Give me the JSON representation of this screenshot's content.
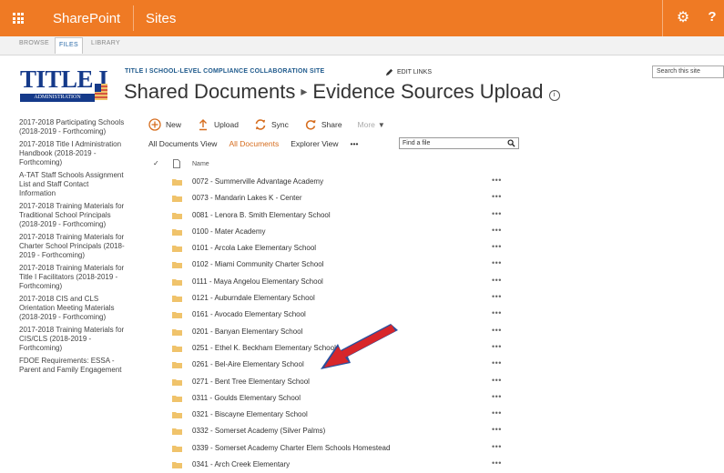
{
  "suite_bar": {
    "brand": "SharePoint",
    "sites": "Sites",
    "help": "?"
  },
  "ribbon": {
    "tabs": [
      "BROWSE",
      "FILES",
      "LIBRARY"
    ]
  },
  "logo": {
    "word": "TITLE I",
    "sub": "ADMINISTRATION"
  },
  "site": {
    "name": "TITLE I SCHOOL-LEVEL COMPLIANCE COLLABORATION SITE",
    "edit_links": "EDIT LINKS",
    "title_part1": "Shared Documents",
    "title_sep": "▸",
    "title_part2": "Evidence Sources Upload",
    "search_placeholder": "Search this site"
  },
  "nav": [
    "2017-2018 Participating Schools (2018-2019 - Forthcoming)",
    "2017-2018 Title I Administration Handbook (2018-2019 - Forthcoming)",
    "A-TAT Staff Schools Assignment List and Staff Contact Information",
    "2017-2018 Training Materials for Traditional School Principals (2018-2019 - Forthcoming)",
    "2017-2018 Training Materials for Charter School Principals (2018-2019 - Forthcoming)",
    "2017-2018 Training Materials for Title I Facilitators (2018-2019 - Forthcoming)",
    "2017-2018 CIS and CLS Orientation Meeting Materials (2018-2019 - Forthcoming)",
    "2017-2018 Training Materials for CIS/CLS (2018-2019 - Forthcoming)",
    "FDOE Requirements: ESSA - Parent and Family Engagement"
  ],
  "commands": {
    "new": "New",
    "upload": "Upload",
    "sync": "Sync",
    "share": "Share",
    "more": "More"
  },
  "views": {
    "all_view": "All Documents View",
    "all_docs": "All Documents",
    "explorer": "Explorer View",
    "ellipsis": "•••",
    "find_placeholder": "Find a file"
  },
  "list": {
    "header_name": "Name",
    "row_menu": "•••",
    "rows": [
      "0072 - Summerville Advantage Academy",
      "0073 - Mandarin Lakes K - Center",
      "0081 - Lenora B. Smith Elementary School",
      "0100 - Mater Academy",
      "0101 - Arcola Lake Elementary School",
      "0102 - Miami Community Charter School",
      "0111 - Maya Angelou Elementary School",
      "0121 - Auburndale Elementary School",
      "0161 - Avocado Elementary School",
      "0201 - Banyan Elementary School",
      "0251 - Ethel K. Beckham Elementary School",
      "0261 - Bel-Aire Elementary School",
      "0271 - Bent Tree Elementary School",
      "0311 - Goulds Elementary School",
      "0321 - Biscayne Elementary School",
      "0332 - Somerset Academy (Silver Palms)",
      "0339 - Somerset Academy Charter Elem Schools Homestead",
      "0341 - Arch Creek Elementary"
    ]
  },
  "colors": {
    "suite_bar": "#ef7a24",
    "active_view": "#d66d1e",
    "link_blue": "#1f5a8c",
    "folder": "#f0c36b",
    "arrow_red": "#d8262a",
    "arrow_blue": "#2a4f9c"
  }
}
